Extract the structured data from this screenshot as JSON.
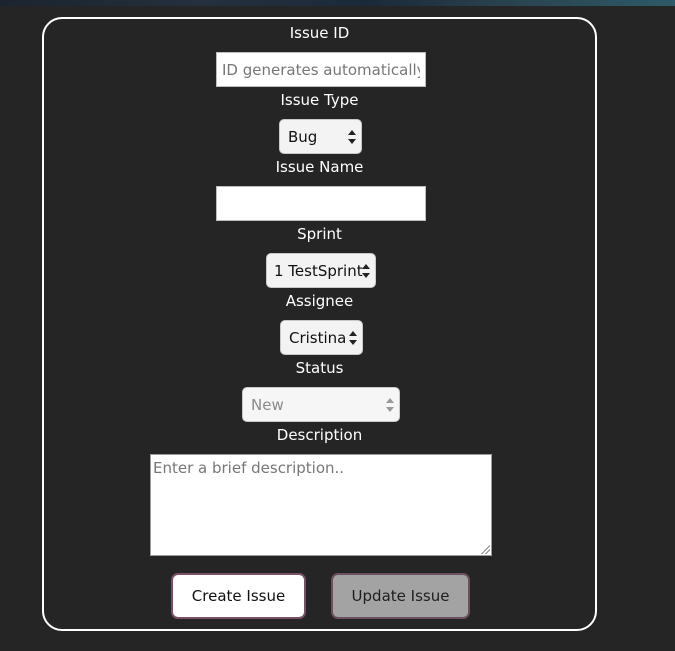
{
  "form": {
    "issue_id": {
      "label": "Issue ID",
      "placeholder": "ID generates automatically",
      "value": ""
    },
    "issue_type": {
      "label": "Issue Type",
      "selected": "Bug"
    },
    "issue_name": {
      "label": "Issue Name",
      "value": ""
    },
    "sprint": {
      "label": "Sprint",
      "selected": "1 TestSprint"
    },
    "assignee": {
      "label": "Assignee",
      "selected": "Cristina"
    },
    "status": {
      "label": "Status",
      "selected": "New",
      "disabled": true
    },
    "description": {
      "label": "Description",
      "placeholder": "Enter a brief description.."
    }
  },
  "buttons": {
    "create_label": "Create Issue",
    "update_label": "Update Issue"
  },
  "colors": {
    "background": "#252525",
    "card_border": "#ffffff",
    "button_border": "#7a5066",
    "update_button_bg": "#a3a3a3"
  },
  "icons": {
    "select_arrows": "up-down-arrows-icon",
    "textarea_resize": "resize-grip-icon"
  }
}
